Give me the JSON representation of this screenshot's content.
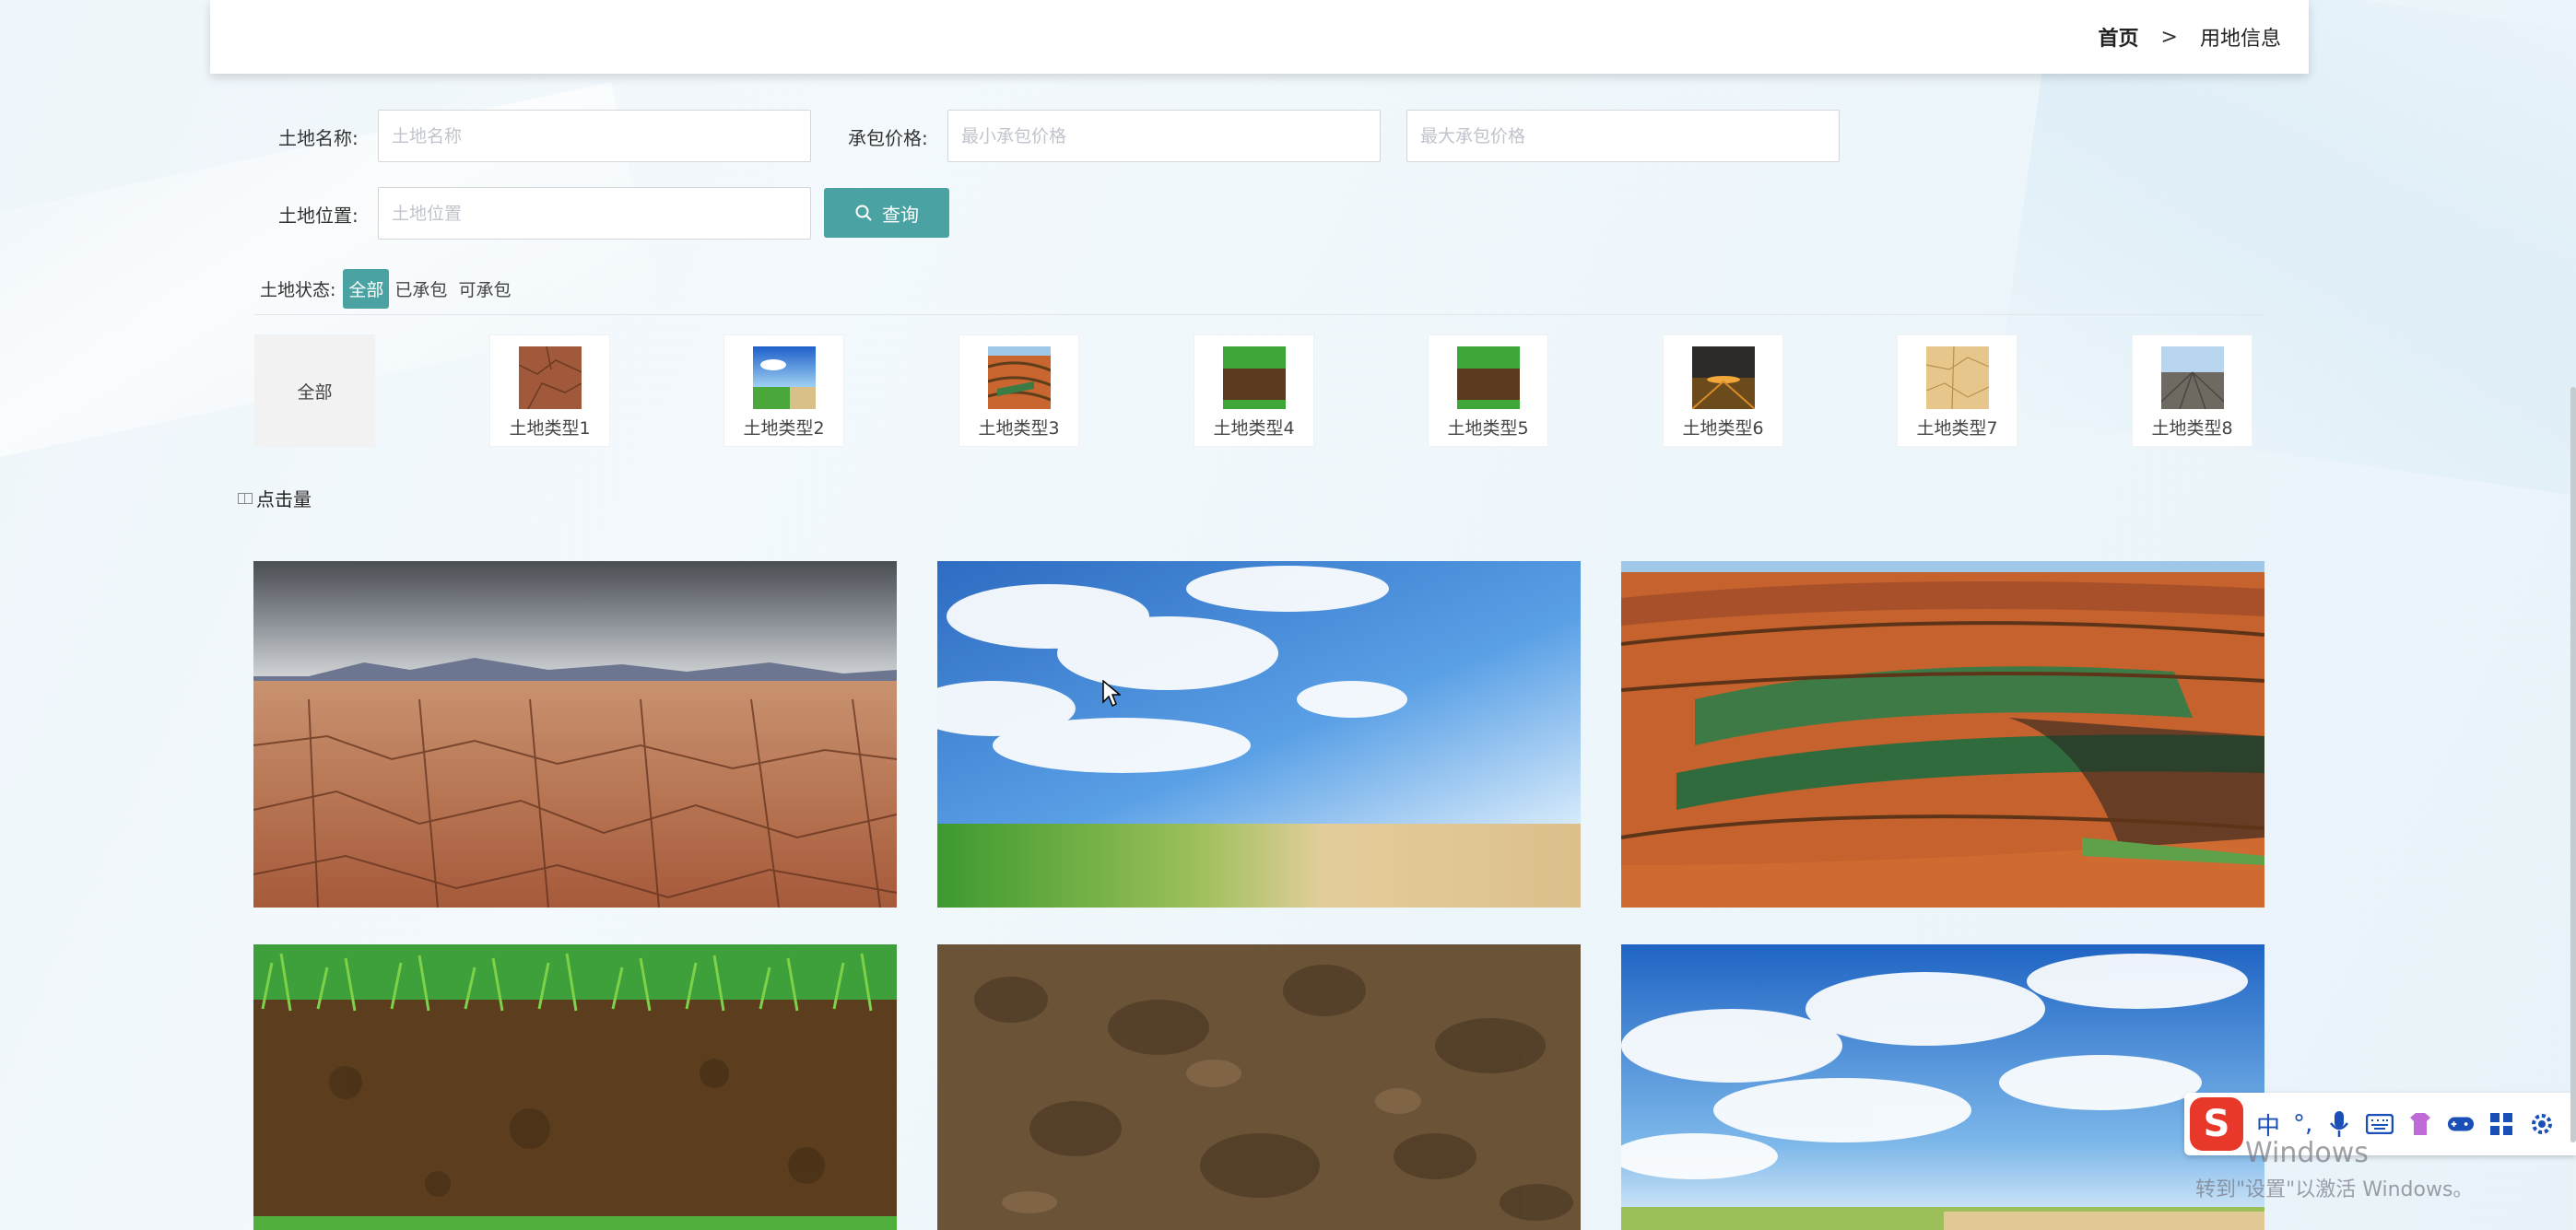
{
  "breadcrumb": {
    "home": "首页",
    "separator": ">",
    "current": "用地信息"
  },
  "search": {
    "land_name_label": "土地名称:",
    "land_name_placeholder": "土地名称",
    "price_label": "承包价格:",
    "min_price_placeholder": "最小承包价格",
    "max_price_placeholder": "最大承包价格",
    "location_label": "土地位置:",
    "location_placeholder": "土地位置",
    "search_button": "查询"
  },
  "status_filter": {
    "label": "土地状态:",
    "options": [
      "全部",
      "已承包",
      "可承包"
    ],
    "selected": "全部"
  },
  "types": {
    "all_label": "全部",
    "items": [
      "土地类型1",
      "土地类型2",
      "土地类型3",
      "土地类型4",
      "土地类型5",
      "土地类型6",
      "土地类型7",
      "土地类型8"
    ]
  },
  "sort": {
    "label": "点击量"
  },
  "ime": {
    "mode": "中",
    "punct": "°,"
  },
  "watermark": {
    "line1": "Windows",
    "line2": "转到\"设置\"以激活 Windows。"
  }
}
